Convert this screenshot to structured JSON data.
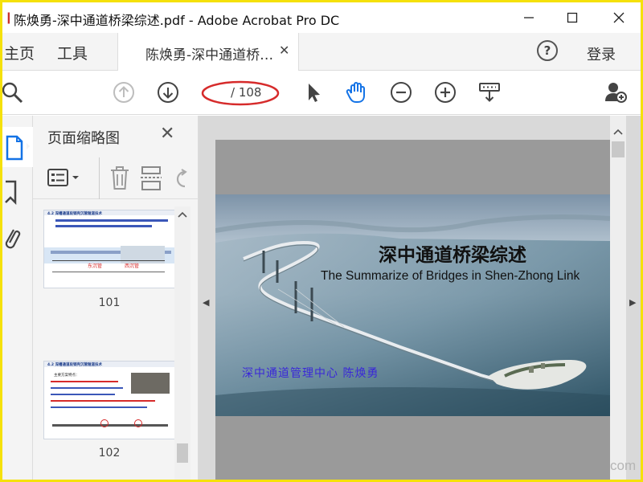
{
  "window": {
    "title": "陈焕勇-深中通道桥梁综述.pdf - Adobe Acrobat Pro DC"
  },
  "tabs": {
    "home": "主页",
    "tools": "工具",
    "document": "陈焕勇-深中通道桥…",
    "help": "?",
    "login": "登录"
  },
  "toolbar": {
    "page_current": "",
    "page_total": "/ 108",
    "icons": [
      "search-icon",
      "page-up-icon",
      "page-down-icon",
      "select-pointer-icon",
      "hand-tool-icon",
      "zoom-out-icon",
      "zoom-in-icon",
      "scroll-mode-icon",
      "add-user-icon"
    ],
    "annotation_color": "#d62b2b"
  },
  "left_strip": {
    "icons": [
      "page-thumbnails-icon",
      "bookmark-icon",
      "attachment-icon"
    ],
    "accent_color": "#1473e6"
  },
  "thumbnails_panel": {
    "title": "页面缩略图",
    "pages": [
      {
        "number": "101",
        "heading": "4.2 深槽通道段钢壳沉管隧道技术",
        "labels": [
          "东沉管",
          "西沉管"
        ]
      },
      {
        "number": "102",
        "heading": "4.2 深槽通道段钢壳沉管隧道技术",
        "lines": [
          "主要方案特点：",
          "方案1：中隔主钢隔室面…",
          "方案2：…"
        ]
      }
    ]
  },
  "slide": {
    "title": "深中通道桥梁综述",
    "subtitle": "The Summarize of Bridges in Shen-Zhong Link",
    "author": "深中通道管理中心  陈焕勇"
  },
  "watermark": "com"
}
